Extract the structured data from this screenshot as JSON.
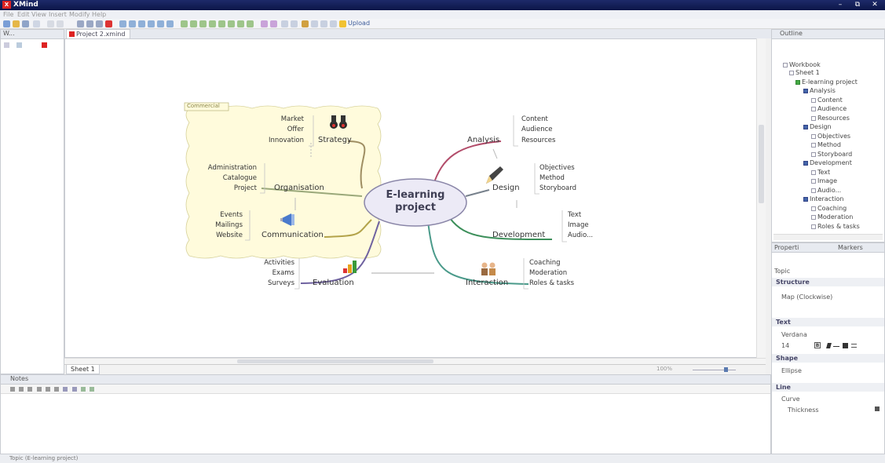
{
  "window": {
    "title": "XMind",
    "logo": "X",
    "min": "–",
    "max": "⧉",
    "close": "✕"
  },
  "menu": [
    "File",
    "Edit",
    "View",
    "Insert",
    "Modify",
    "Help"
  ],
  "toolbar": {
    "upload": "Upload"
  },
  "left_panel": {
    "title": "W..."
  },
  "editor": {
    "tab": "Project 2.xmind"
  },
  "map": {
    "central": "E-learning project",
    "boundary_label": "Commercial",
    "branches": [
      {
        "label": "Strategy",
        "children": [
          "Market",
          "Offer",
          "Innovation"
        ]
      },
      {
        "label": "Organisation",
        "children": [
          "Administration",
          "Catalogue",
          "Project"
        ]
      },
      {
        "label": "Communication",
        "children": [
          "Events",
          "Mailings",
          "Website"
        ]
      },
      {
        "label": "Evaluation",
        "children": [
          "Activities",
          "Exams",
          "Surveys"
        ]
      },
      {
        "label": "Analysis",
        "children": [
          "Content",
          "Audience",
          "Resources"
        ]
      },
      {
        "label": "Design",
        "children": [
          "Objectives",
          "Method",
          "Storyboard"
        ]
      },
      {
        "label": "Development",
        "children": [
          "Text",
          "Image",
          "Audio..."
        ]
      },
      {
        "label": "Interaction",
        "children": [
          "Coaching",
          "Moderation",
          "Roles & tasks"
        ]
      }
    ]
  },
  "sheet_tab": "Sheet 1",
  "zoom": "100%",
  "notes": {
    "title": "Notes"
  },
  "status": "Topic (E-learning project)",
  "outline": {
    "title": "Outline",
    "items": [
      "Workbook",
      "Sheet 1",
      "E-learning project",
      "Analysis",
      "Content",
      "Audience",
      "Resources",
      "Design",
      "Objectives",
      "Method",
      "Storyboard",
      "Development",
      "Text",
      "Image",
      "Audio...",
      "Interaction",
      "Coaching",
      "Moderation",
      "Roles & tasks"
    ]
  },
  "properties": {
    "tab1": "Properti",
    "tab2": "Markers",
    "topic": "Topic",
    "structure_title": "Structure",
    "structure_value": "Map (Clockwise)",
    "text_title": "Text",
    "font": "Verdana",
    "size": "14",
    "shape_title": "Shape",
    "shape_value": "Ellipse",
    "line_title": "Line",
    "line_value": "Curve",
    "thickness": "Thickness"
  },
  "colors": {
    "title_bar": "#0c1648",
    "boundary": "#fffbdc",
    "central_fill": "#eceaf6",
    "central_border": "#8a86a8"
  }
}
